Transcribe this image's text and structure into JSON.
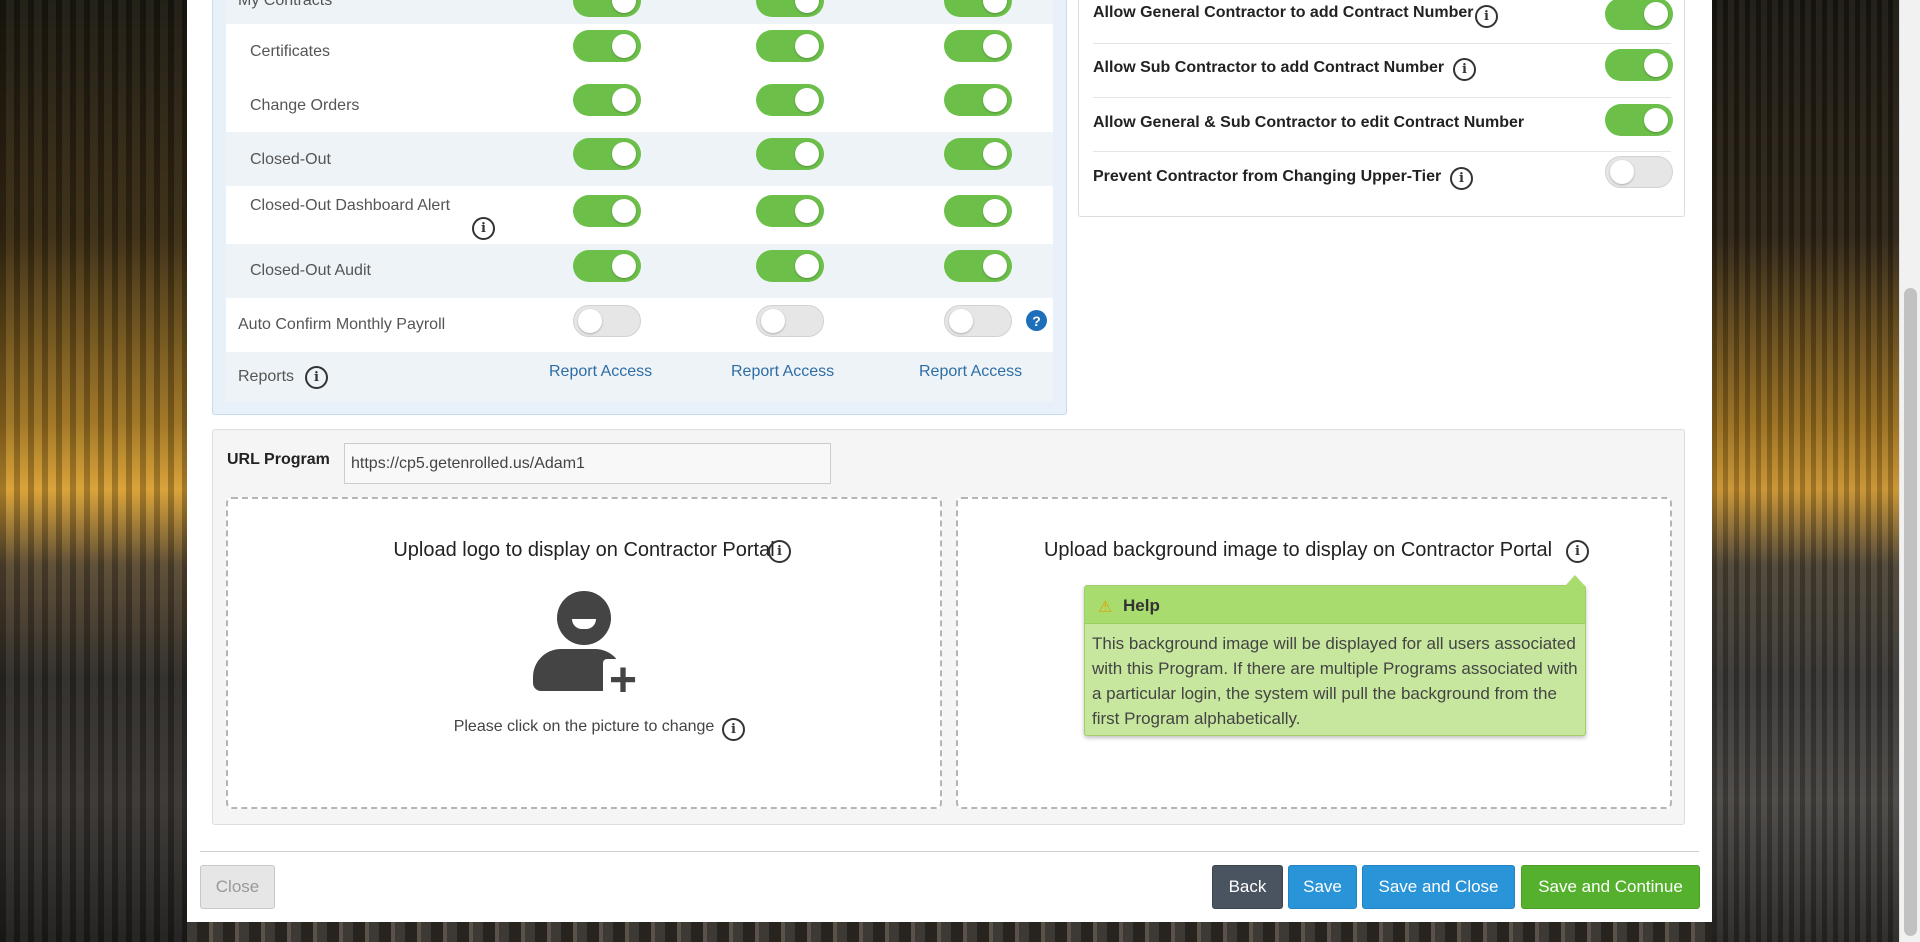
{
  "permissions": {
    "partial_row_label": "My Contracts",
    "rows": [
      {
        "label": "Certificates",
        "toggles": [
          true,
          true,
          true
        ]
      },
      {
        "label": "Change Orders",
        "toggles": [
          true,
          true,
          true
        ]
      },
      {
        "label": "Closed-Out",
        "toggles": [
          true,
          true,
          true
        ]
      },
      {
        "label": "Closed-Out Dashboard Alert",
        "toggles": [
          true,
          true,
          true
        ],
        "info": "info-icon"
      },
      {
        "label": "Closed-Out Audit",
        "toggles": [
          true,
          true,
          true
        ]
      },
      {
        "label": "Auto Confirm Monthly Payroll",
        "toggles": [
          false,
          false,
          false
        ],
        "help": "question-icon"
      }
    ],
    "reports": {
      "label": "Reports",
      "links": [
        "Report Access",
        "Report Access",
        "Report Access"
      ]
    }
  },
  "contract_settings": [
    {
      "label": "Allow General Contractor to add Contract Number",
      "enabled": true,
      "info": true
    },
    {
      "label": "Allow Sub Contractor to add Contract Number",
      "enabled": true,
      "info": true
    },
    {
      "label": "Allow General & Sub Contractor to edit Contract Number",
      "enabled": true,
      "info": false
    },
    {
      "label": "Prevent Contractor from Changing Upper-Tier",
      "enabled": false,
      "info": true
    }
  ],
  "url_program": {
    "label": "URL Program",
    "value": "https://cp5.getenrolled.us/Adam1"
  },
  "upload_logo": {
    "title": "Upload logo to display on Contractor Portal",
    "caption": "Please click on the picture to change",
    "icon": "user-add-icon"
  },
  "upload_background": {
    "title": "Upload background image to display on Contractor Portal"
  },
  "tooltip": {
    "icon": "warning-icon",
    "title": "Help",
    "body": "This background image will be displayed for all users associated with this Program. If there are multiple Programs associated with a particular login, the system will pull the background from the first Program alphabetically."
  },
  "footer": {
    "close_label": "Close",
    "back_label": "Back",
    "save_label": "Save",
    "save_close_label": "Save and Close",
    "save_continue_label": "Save and Continue"
  },
  "colors": {
    "toggle_on": "#6cc04a",
    "primary": "#2a94d9",
    "success": "#55b12d",
    "tooltip_bg": "#c7e79e"
  }
}
